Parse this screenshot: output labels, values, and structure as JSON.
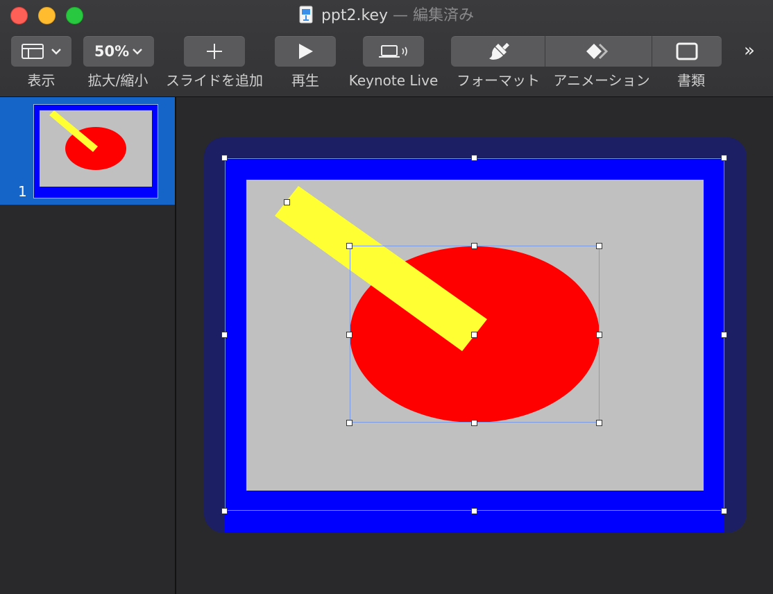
{
  "window": {
    "filename": "ppt2.key",
    "edited_suffix": " — 編集済み"
  },
  "toolbar": {
    "view_label": "表示",
    "zoom_value": "50%",
    "zoom_label": "拡大/縮小",
    "add_slide_label": "スライドを追加",
    "play_label": "再生",
    "keynote_live_label": "Keynote Live",
    "format_label": "フォーマット",
    "animate_label": "アニメーション",
    "document_label": "書類",
    "more_label": "»"
  },
  "navigator": {
    "slides": [
      {
        "number": "1"
      }
    ]
  },
  "colors": {
    "slide_border_blue": "#0000ff",
    "slide_background_gray": "#c0c0c0",
    "ellipse_red": "#ff0000",
    "bar_yellow": "#ffff33",
    "selection_accent": "#1565c8"
  }
}
